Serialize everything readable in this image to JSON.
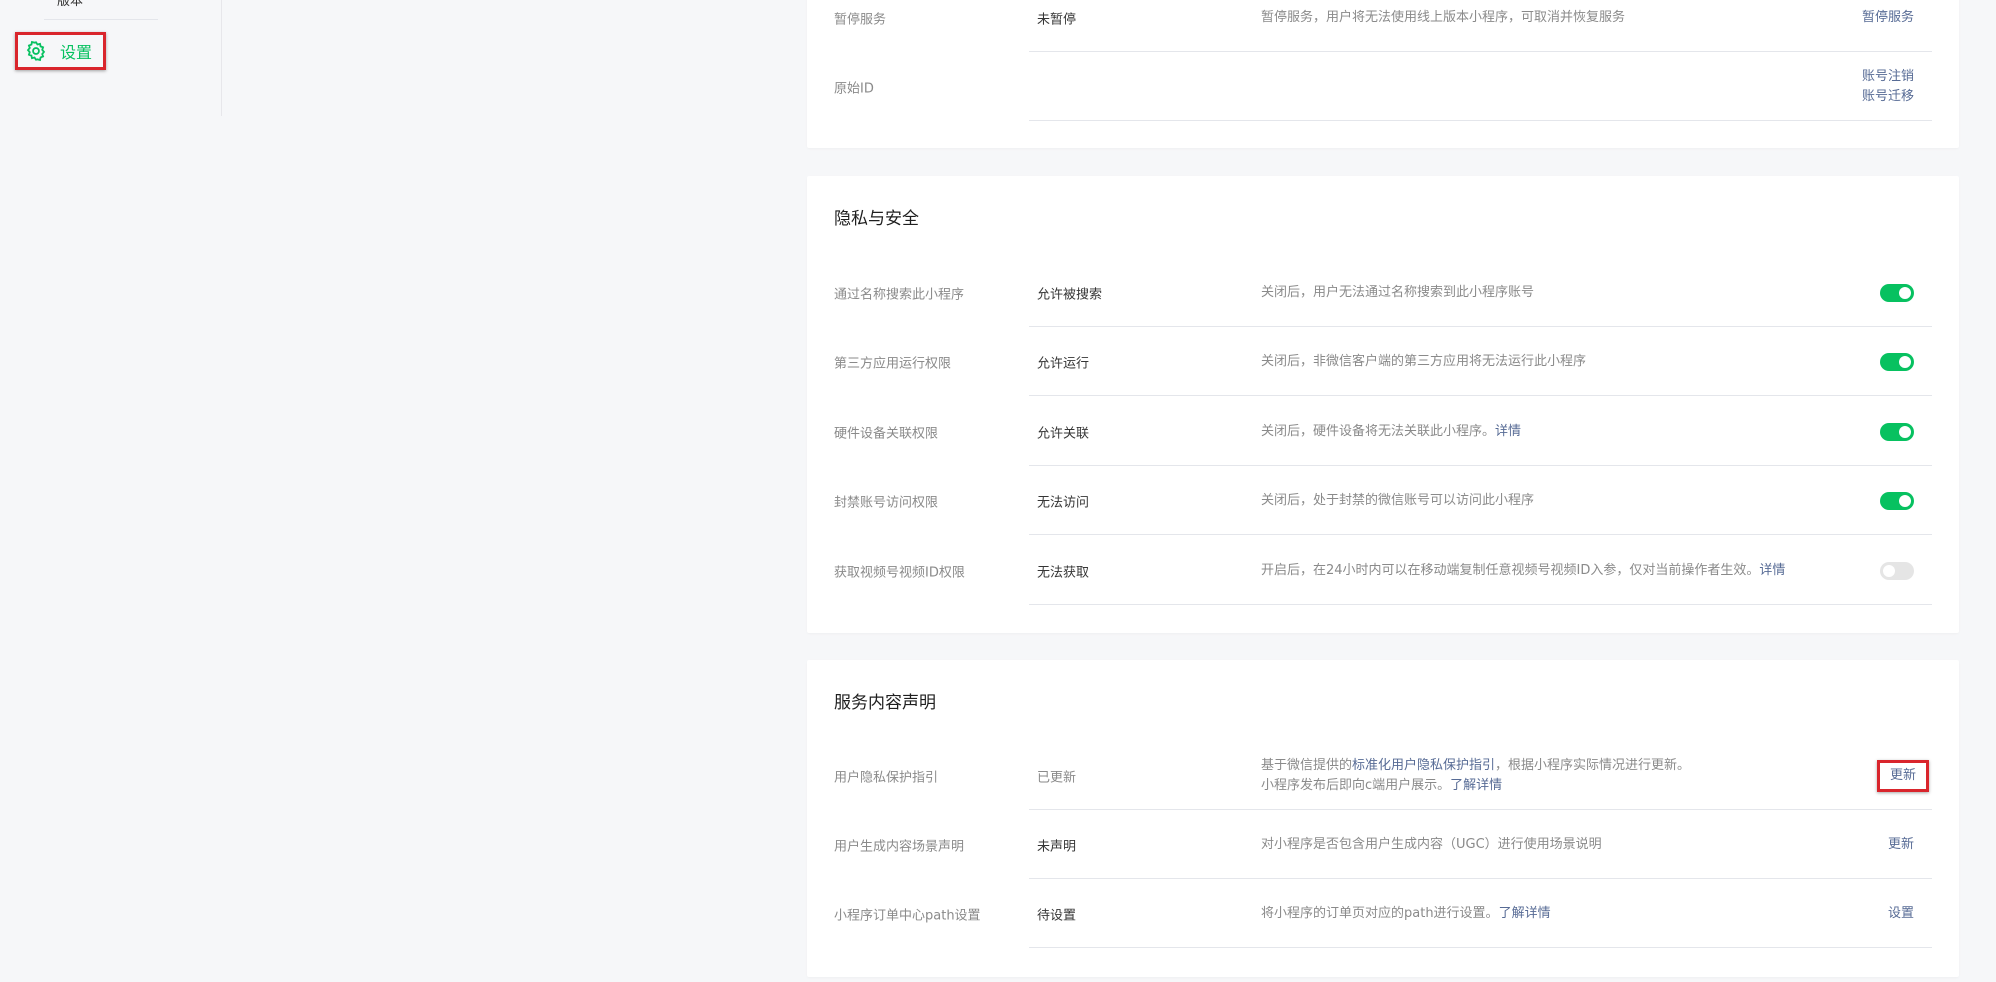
{
  "sidebar": {
    "clipped_item": "版本",
    "settings_label": "设置"
  },
  "account_card": {
    "rows": [
      {
        "label": "暂停服务",
        "status": "未暂停",
        "desc": "暂停服务，用户将无法使用线上版本小程序，可取消并恢复服务",
        "action": "暂停服务"
      },
      {
        "label": "原始ID",
        "status": "",
        "desc": "",
        "actions": [
          "账号注销",
          "账号迁移"
        ]
      }
    ]
  },
  "privacy_card": {
    "title": "隐私与安全",
    "rows": [
      {
        "label": "通过名称搜索此小程序",
        "status": "允许被搜索",
        "desc": "关闭后，用户无法通过名称搜索到此小程序账号",
        "switch_on": true
      },
      {
        "label": "第三方应用运行权限",
        "status": "允许运行",
        "desc": "关闭后，非微信客户端的第三方应用将无法运行此小程序",
        "switch_on": true
      },
      {
        "label": "硬件设备关联权限",
        "status": "允许关联",
        "desc": "关闭后，硬件设备将无法关联此小程序。",
        "desc_link": "详情",
        "switch_on": true
      },
      {
        "label": "封禁账号访问权限",
        "status": "无法访问",
        "desc": "关闭后，处于封禁的微信账号可以访问此小程序",
        "switch_on": true
      },
      {
        "label": "获取视频号视频ID权限",
        "status": "无法获取",
        "desc": "开启后，在24小时内可以在移动端复制任意视频号视频ID入参，仅对当前操作者生效。",
        "desc_link": "详情",
        "switch_on": false
      }
    ]
  },
  "service_card": {
    "title": "服务内容声明",
    "rows": [
      {
        "label": "用户隐私保护指引",
        "status": "已更新",
        "desc_line1_pre": "基于微信提供的",
        "desc_line1_link": "标准化用户隐私保护指引",
        "desc_line1_post": "，根据小程序实际情况进行更新。",
        "desc_line2_pre": "小程序发布后即向c端用户展示。",
        "desc_line2_link": "了解详情",
        "action": "更新"
      },
      {
        "label": "用户生成内容场景声明",
        "status": "未声明",
        "desc": "对小程序是否包含用户生成内容（UGC）进行使用场景说明",
        "action": "更新"
      },
      {
        "label": "小程序订单中心path设置",
        "status": "待设置",
        "desc": "将小程序的订单页对应的path进行设置。",
        "desc_link": "了解详情",
        "action": "设置"
      }
    ]
  },
  "colors": {
    "accent_green": "#07c160",
    "link_blue": "#576b95",
    "highlight_red": "#d9252c"
  }
}
